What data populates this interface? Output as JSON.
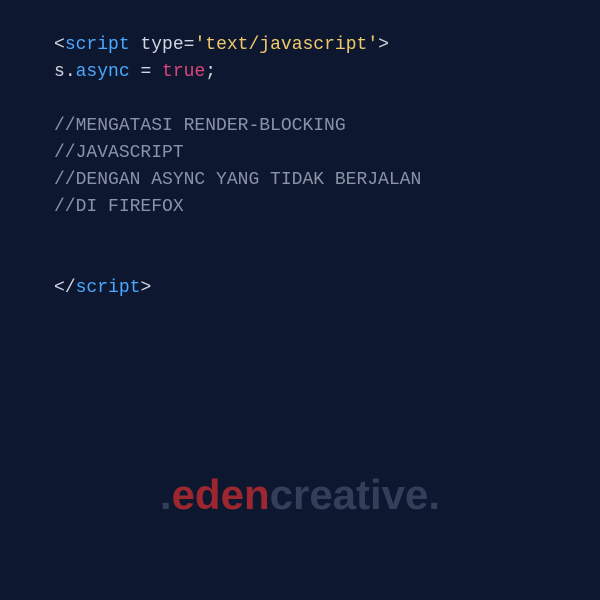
{
  "code": {
    "open_angle": "<",
    "close_angle": ">",
    "slash": "/",
    "script_tag": "script",
    "type_attr": "type",
    "eq": "=",
    "quote": "'",
    "type_value": "text/javascript",
    "stmt_obj": "s",
    "dot": ".",
    "stmt_prop": "async",
    "assign": " = ",
    "stmt_val": "true",
    "semicolon": ";",
    "comment_prefix": "//",
    "comment1": "MENGATASI RENDER-BLOCKING",
    "comment2": "JAVASCRIPT",
    "comment3": "DENGAN ASYNC YANG TIDAK BERJALAN",
    "comment4": "DI FIREFOX"
  },
  "watermark": {
    "dot1": ".",
    "part1": "eden",
    "part2": "creative",
    "dot2": "."
  }
}
